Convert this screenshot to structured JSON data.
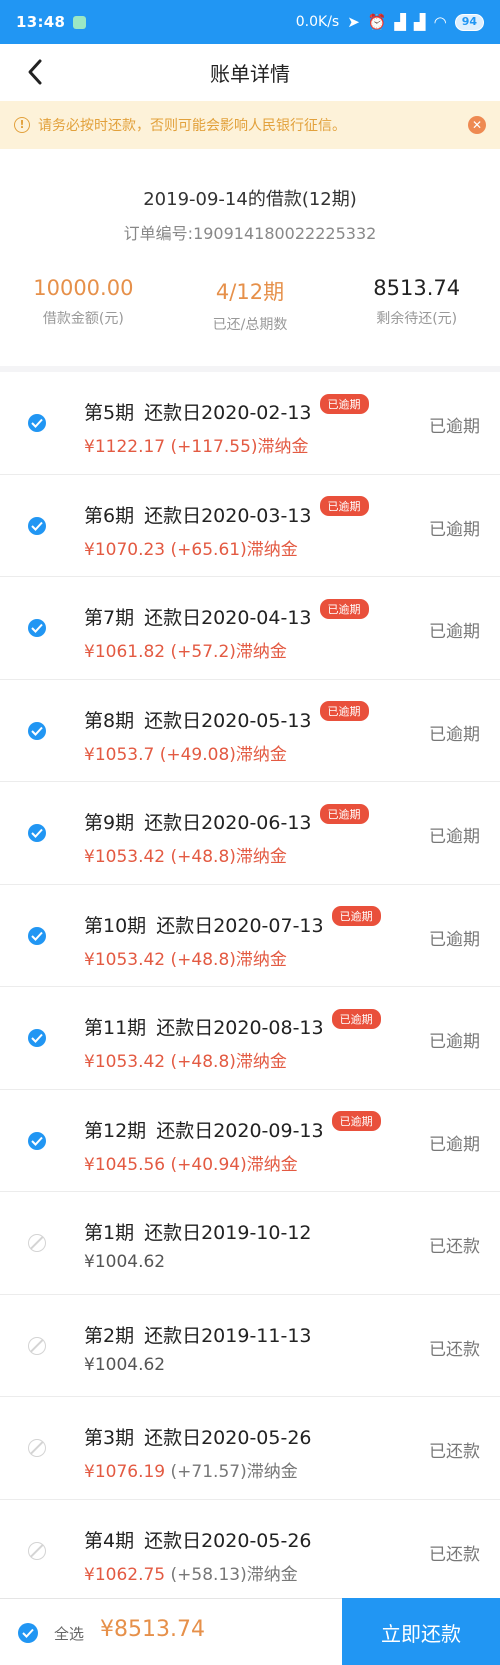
{
  "statusbar": {
    "time": "13:48",
    "network_speed": "0.0K/s",
    "battery": "94"
  },
  "header": {
    "title": "账单详情"
  },
  "notice": {
    "text": "请务必按时还款，否则可能会影响人民银行征信。"
  },
  "summary": {
    "loan_title": "2019-09-14的借款(12期)",
    "order_no": "订单编号:190914180022225332",
    "loan_amount": "10000.00",
    "loan_amount_label": "借款金额(元)",
    "progress": "4/12期",
    "progress_label": "已还/总期数",
    "remaining": "8513.74",
    "remaining_label": "剩余待还(元)"
  },
  "rows": [
    {
      "period": "第5期",
      "due": "还款日2020-02-13",
      "tag": "已逾期",
      "amount": "¥1122.17",
      "late": " (+117.55)滞纳金",
      "status": "已逾期"
    },
    {
      "period": "第6期",
      "due": "还款日2020-03-13",
      "tag": "已逾期",
      "amount": "¥1070.23",
      "late": " (+65.61)滞纳金",
      "status": "已逾期"
    },
    {
      "period": "第7期",
      "due": "还款日2020-04-13",
      "tag": "已逾期",
      "amount": "¥1061.82",
      "late": " (+57.2)滞纳金",
      "status": "已逾期"
    },
    {
      "period": "第8期",
      "due": "还款日2020-05-13",
      "tag": "已逾期",
      "amount": "¥1053.7",
      "late": " (+49.08)滞纳金",
      "status": "已逾期"
    },
    {
      "period": "第9期",
      "due": "还款日2020-06-13",
      "tag": "已逾期",
      "amount": "¥1053.42",
      "late": " (+48.8)滞纳金",
      "status": "已逾期"
    },
    {
      "period": "第10期",
      "due": "还款日2020-07-13",
      "tag": "已逾期",
      "amount": "¥1053.42",
      "late": " (+48.8)滞纳金",
      "status": "已逾期"
    },
    {
      "period": "第11期",
      "due": "还款日2020-08-13",
      "tag": "已逾期",
      "amount": "¥1053.42",
      "late": " (+48.8)滞纳金",
      "status": "已逾期"
    },
    {
      "period": "第12期",
      "due": "还款日2020-09-13",
      "tag": "已逾期",
      "amount": "¥1045.56",
      "late": " (+40.94)滞纳金",
      "status": "已逾期"
    },
    {
      "period": "第1期",
      "due": "还款日2019-10-12",
      "tag": "",
      "amount": "¥1004.62",
      "late": "",
      "status": "已还款"
    },
    {
      "period": "第2期",
      "due": "还款日2019-11-13",
      "tag": "",
      "amount": "¥1004.62",
      "late": "",
      "status": "已还款"
    },
    {
      "period": "第3期",
      "due": "还款日2020-05-26",
      "tag": "",
      "amount": "¥1076.19",
      "late": " (+71.57)滞纳金",
      "status": "已还款"
    },
    {
      "period": "第4期",
      "due": "还款日2020-05-26",
      "tag": "",
      "amount": "¥1062.75",
      "late": " (+58.13)滞纳金",
      "status": "已还款"
    }
  ],
  "bottom": {
    "select_all": "全选",
    "total": "¥8513.74",
    "pay_button": "立即还款"
  },
  "colors": {
    "primary": "#2196f3",
    "overdue_red": "#e35a42",
    "orange": "#e6904a",
    "notice_bg": "#fdf2d9"
  }
}
